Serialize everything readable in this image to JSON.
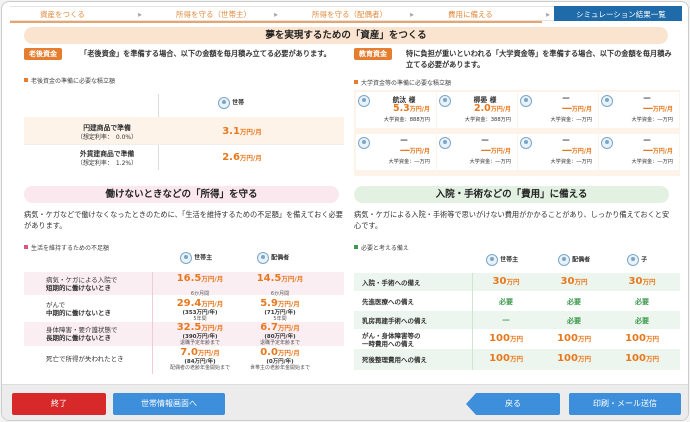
{
  "steps": [
    {
      "label": "資産をつくる",
      "active": false
    },
    {
      "label": "所得を守る（世帯主）",
      "active": false
    },
    {
      "label": "所得を守る（配偶者）",
      "active": false
    },
    {
      "label": "費用に備える",
      "active": false
    },
    {
      "label": "シミュレーション結果一覧",
      "active": true
    }
  ],
  "assets": {
    "title": "夢を実現するための「資産」をつくる",
    "retirement": {
      "tag": "老後資金",
      "lead": "「老後資金」を準備する場合、以下の金額を毎月積み立てる必要があります。",
      "table_heading": "老後資金の準備に必要な積立額",
      "household_label": "世帯",
      "yen_label": "円建商品で準備",
      "yen_rate": "（想定利率：　0.0%）",
      "yen_value": "3.1",
      "foreign_label": "外貨建商品で準備",
      "foreign_rate": "（想定利率：　1.2%）",
      "foreign_value": "2.6",
      "unit": "万円/月"
    },
    "education": {
      "tag": "教育資金",
      "lead": "特に負担が重いといわれる「大学資金等」を準備する場合、以下の金額を毎月積み立てる必要があります。",
      "table_heading": "大学資金等の準備に必要な積立額",
      "unit": "万円/月",
      "total_prefix": "大学資金：",
      "children": [
        {
          "name": "航汰 様",
          "amount": "5.3",
          "total": "888万円"
        },
        {
          "name": "柳晏 様",
          "amount": "2.0",
          "total": "388万円"
        },
        {
          "name": "―",
          "amount": "―",
          "total": "―万円"
        },
        {
          "name": "―",
          "amount": "―",
          "total": "―万円"
        },
        {
          "name": "―",
          "amount": "―",
          "total": "―万円"
        },
        {
          "name": "―",
          "amount": "―",
          "total": "―万円"
        },
        {
          "name": "―",
          "amount": "―",
          "total": "―万円"
        },
        {
          "name": "―",
          "amount": "―",
          "total": "―万円"
        }
      ]
    }
  },
  "income": {
    "title": "働けないときなどの「所得」を守る",
    "lead": "病気・ケガなどで働けなくなったときのために、「生活を維持するための不足額」を備えておく必要があります。",
    "table_heading": "生活を維持するための不足額",
    "col_head": "世帯主",
    "col_spouse": "配偶者",
    "unit": "万円/月",
    "rows": [
      {
        "label1": "病気・ケガによる入院で",
        "label2": "短期的に働けないとき",
        "head": "16.5",
        "spouse": "14.5",
        "head_note": "",
        "spouse_note": ""
      },
      {
        "label1": "がんで",
        "label2": "中期的に働けないとき",
        "head": "29.4",
        "spouse": "5.9",
        "head_sub": "(353万円/年)",
        "spouse_sub": "(71万円/年)",
        "head_pre": "6か月間",
        "spouse_pre": "6か月間",
        "head_note": "5年間",
        "spouse_note": "5年間"
      },
      {
        "label1": "身体障害・要介護状態で",
        "label2": "長期的に働けないとき",
        "head": "32.5",
        "spouse": "6.7",
        "head_sub": "(390万円/年)",
        "spouse_sub": "(80万円/年)",
        "head_note": "退職予定年齢まで",
        "spouse_note": "退職予定年齢まで"
      },
      {
        "label1": "死亡で所得が失われたとき",
        "label2": "",
        "head": "7.0",
        "spouse": "0.0",
        "head_sub": "(84万円/年)",
        "spouse_sub": "(0万円/年)",
        "head_note": "配偶者の老齢年金開始まで",
        "spouse_note": "世帯主の老齢年金開始まで"
      }
    ]
  },
  "costs": {
    "title": "入院・手術などの「費用」に備える",
    "lead": "病気・ケガによる入院・手術等で思いがけない費用がかかることがあり、しっかり備えておくと安心です。",
    "table_heading": "必要と考える備え",
    "col_head": "世帯主",
    "col_spouse": "配偶者",
    "col_child": "子",
    "rows": [
      {
        "label": "入院・手術への備え",
        "head": "30",
        "spouse": "30",
        "child": "30",
        "unit": "万円"
      },
      {
        "label": "先進医療への備え",
        "head": "必要",
        "spouse": "必要",
        "child": "必要",
        "unit": ""
      },
      {
        "label": "乳房再建手術への備え",
        "head": "―",
        "spouse": "必要",
        "child": "必要",
        "unit": ""
      },
      {
        "label": "がん・身体障害等の",
        "label2": "一時費用への備え",
        "head": "100",
        "spouse": "100",
        "child": "100",
        "unit": "万円"
      },
      {
        "label": "死後整理費用への備え",
        "head": "100",
        "spouse": "100",
        "child": "100",
        "unit": "万円"
      }
    ]
  },
  "footer": {
    "end": "終了",
    "household_info": "世帯情報画面へ",
    "back": "戻る",
    "print_mail": "印刷・メール送信"
  }
}
